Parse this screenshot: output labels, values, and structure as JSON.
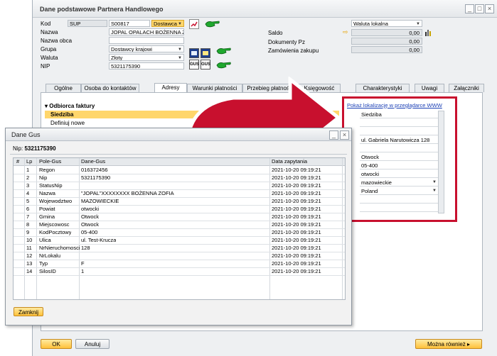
{
  "main": {
    "title": "Dane podstawowe Partnera Handlowego",
    "fields": {
      "kod_label": "Kod",
      "kod_prefix": "SUP",
      "kod_value": "S00817",
      "kod_type": "Dostawca",
      "nazwa_label": "Nazwa",
      "nazwa_value": "JOPAL OPALACH BOŻENNA ZO",
      "nazwa_obca_label": "Nazwa obca",
      "grupa_label": "Grupa",
      "grupa_value": "Dostawcy krajowi",
      "waluta_label": "Waluta",
      "waluta_value": "Złoty",
      "nip_label": "NIP",
      "nip_value": "5321175390"
    },
    "right_fields": {
      "waluta_lokalna": "Waluta lokalna",
      "saldo_label": "Saldo",
      "saldo_value": "0,00",
      "dokumenty_label": "Dokumenty Pz",
      "dokumenty_value": "0,00",
      "zamowienia_label": "Zamówienia zakupu",
      "zamowienia_value": "0,00"
    },
    "tabs": [
      {
        "label": "Ogólne"
      },
      {
        "label": "Osoba do kontaktów"
      },
      {
        "label": "Adresy"
      },
      {
        "label": "Warunki płatności"
      },
      {
        "label": "Przebieg płatności"
      },
      {
        "label": "Księgowość"
      },
      {
        "label": "Charakterystyki"
      },
      {
        "label": "Uwagi"
      },
      {
        "label": "Załączniki"
      }
    ],
    "address_tree": {
      "group": "Odbiorca faktury",
      "selected": "Siedziba",
      "new": "Definiuj nowe"
    },
    "address_link": "Pokaż lokalizację w przeglądarce WWW",
    "address_values": [
      "Siedziba",
      "",
      "",
      "ul. Gabriela Narutowicza 128",
      "",
      "Otwock",
      "05-400",
      "otwocki",
      "mazowieckie",
      "Poland",
      "",
      ""
    ],
    "buttons": {
      "ok": "OK",
      "cancel": "Anuluj",
      "more": "Można również"
    },
    "colors": {
      "highlight": "#ffd66b",
      "accent_red": "#c8102e"
    }
  },
  "gus": {
    "title": "Dane Gus",
    "nip_label": "Nip:",
    "nip_value": "5321175390",
    "columns": [
      "#",
      "Lp",
      "Pole-Gus",
      "Dane-Gus",
      "Data zapytania"
    ],
    "rows": [
      {
        "lp": "1",
        "pole": "Regon",
        "dane": "016372456",
        "data": "2021-10-20 09:19:21"
      },
      {
        "lp": "2",
        "pole": "Nip",
        "dane": "5321175390",
        "data": "2021-10-20 09:19:21"
      },
      {
        "lp": "3",
        "pole": "StatusNip",
        "dane": "",
        "data": "2021-10-20 09:19:21"
      },
      {
        "lp": "4",
        "pole": "Nazwa",
        "dane": "\"JOPAL\"XXXXXXXX BOŻENNA ZOFIA",
        "data": "2021-10-20 09:19:21"
      },
      {
        "lp": "5",
        "pole": "Wojewodztwo",
        "dane": "MAZOWIECKIE",
        "data": "2021-10-20 09:19:21"
      },
      {
        "lp": "6",
        "pole": "Powiat",
        "dane": "otwocki",
        "data": "2021-10-20 09:19:21"
      },
      {
        "lp": "7",
        "pole": "Gmina",
        "dane": "Otwock",
        "data": "2021-10-20 09:19:21"
      },
      {
        "lp": "8",
        "pole": "Miejscowosc",
        "dane": "Otwock",
        "data": "2021-10-20 09:19:21"
      },
      {
        "lp": "9",
        "pole": "KodPocztowy",
        "dane": "05-400",
        "data": "2021-10-20 09:19:21"
      },
      {
        "lp": "10",
        "pole": "Ulica",
        "dane": "ul. Test-Krucza",
        "data": "2021-10-20 09:19:21"
      },
      {
        "lp": "11",
        "pole": "NrNieruchomosci",
        "dane": "128",
        "data": "2021-10-20 09:19:21"
      },
      {
        "lp": "12",
        "pole": "NrLokalu",
        "dane": "",
        "data": "2021-10-20 09:19:21"
      },
      {
        "lp": "13",
        "pole": "Typ",
        "dane": "F",
        "data": "2021-10-20 09:19:21"
      },
      {
        "lp": "14",
        "pole": "SilosID",
        "dane": "1",
        "data": "2021-10-20 09:19:21"
      }
    ],
    "close_button": "Zamknij"
  }
}
